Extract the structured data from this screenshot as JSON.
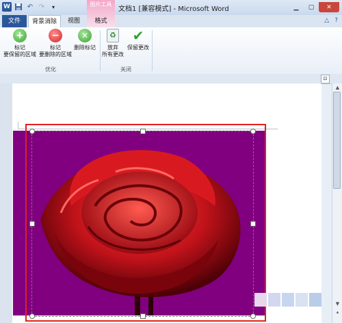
{
  "window": {
    "title": "文档1 [兼容模式] - Microsoft Word",
    "context_tab_group": "图片工具"
  },
  "tabs": {
    "file": "文件",
    "background_removal": "背景消除",
    "view": "视图",
    "format": "格式"
  },
  "ribbon": {
    "mark_keep": "标记\n要保留的区域",
    "mark_keep_l1": "标记",
    "mark_keep_l2": "要保留的区域",
    "mark_remove_l1": "标记",
    "mark_remove_l2": "要删除的区域",
    "delete_mark": "删除标记",
    "discard_l1": "放弃",
    "discard_l2": "所有更改",
    "keep_changes": "保留更改",
    "group_optimize": "优化",
    "group_close": "关闭"
  },
  "colors": {
    "accent": "#2b579a",
    "image_bg": "#800080",
    "rose": "#c0121a",
    "marquee": "#e0201a"
  },
  "icons": [
    "word-logo-icon",
    "save-icon",
    "undo-icon",
    "redo-icon",
    "customize-icon",
    "plus-icon",
    "minus-icon",
    "delete-mark-icon",
    "discard-icon",
    "checkmark-icon"
  ]
}
